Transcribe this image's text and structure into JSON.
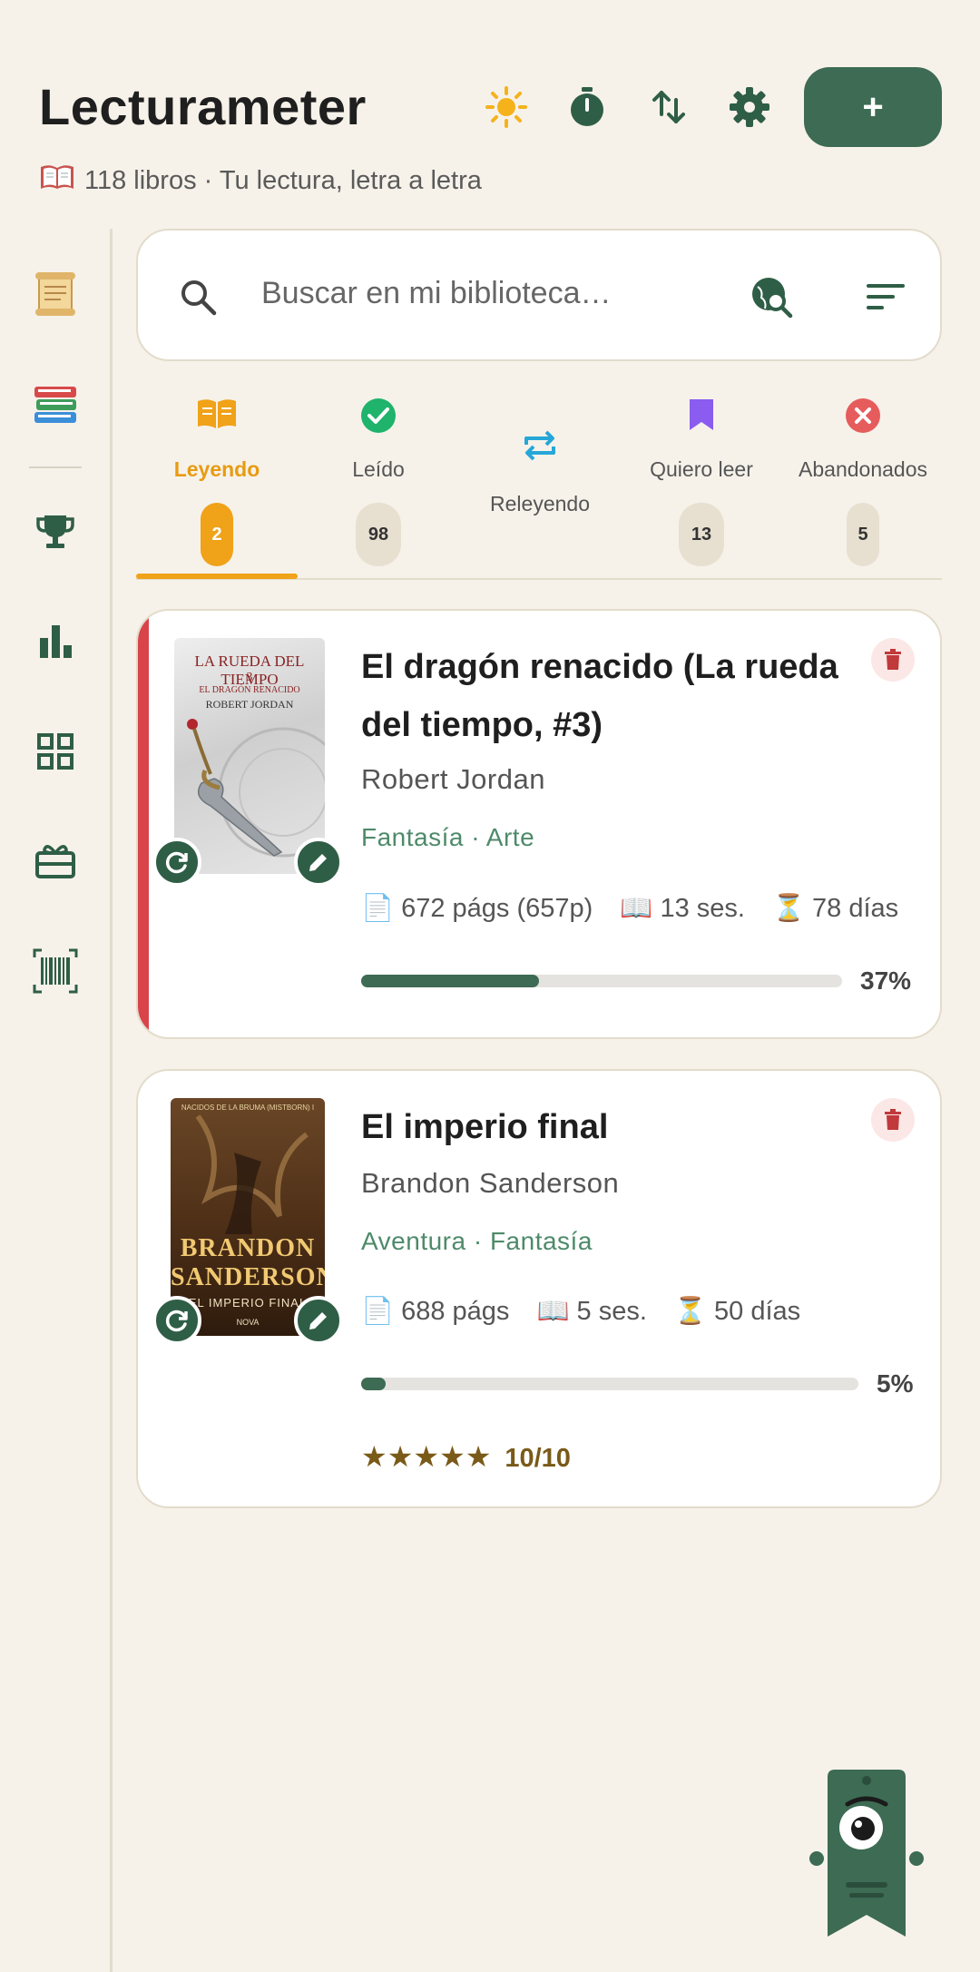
{
  "app": {
    "title": "Lecturameter",
    "subtitle_icon": "open-book-emoji",
    "subtitle": "118 libros · Tu lectura, letra a letra",
    "add_label": "+"
  },
  "header_icons": [
    "sun-icon",
    "timer-icon",
    "sort-arrows-icon",
    "gear-icon"
  ],
  "sidebar": {
    "items": [
      {
        "icon": "scroll-icon"
      },
      {
        "icon": "books-stack-icon"
      },
      {
        "icon": "trophy-icon"
      },
      {
        "icon": "bar-chart-icon"
      },
      {
        "icon": "grid-icon"
      },
      {
        "icon": "gift-card-icon"
      },
      {
        "icon": "barcode-icon"
      }
    ]
  },
  "search": {
    "placeholder": "Buscar en mi biblioteca…"
  },
  "tabs": [
    {
      "label": "Leyendo",
      "count": "2",
      "active": true,
      "icon": "open-book-icon",
      "color": "#f0a218"
    },
    {
      "label": "Leído",
      "count": "98",
      "icon": "check-circle-icon",
      "color": "#1fb36c"
    },
    {
      "label": "Releyendo",
      "count": "",
      "icon": "repeat-icon",
      "color": "#26a7d8"
    },
    {
      "label": "Quiero leer",
      "count": "13",
      "icon": "bookmark-icon",
      "color": "#8a5cf0"
    },
    {
      "label": "Abandonados",
      "count": "5",
      "icon": "x-circle-icon",
      "color": "#e65c5c"
    }
  ],
  "books": [
    {
      "title": "El dragón renacido (La rueda del tiempo, #3)",
      "author": "Robert Jordan",
      "genres": "Fantasía · Arte",
      "pages": "672 págs (657p)",
      "sessions": "13 ses.",
      "days": "78 días",
      "progress": 0.37,
      "progress_label": "37%",
      "cover": {
        "series": "LA RUEDA DEL TIEMPO",
        "number": "3",
        "subtitle": "EL DRAGÓN RENACIDO",
        "author": "ROBERT JORDAN"
      }
    },
    {
      "title": "El imperio final",
      "author": "Brandon Sanderson",
      "genres": "Aventura · Fantasía",
      "pages": "688 págs",
      "sessions": "5 ses.",
      "days": "50 días",
      "progress": 0.05,
      "progress_label": "5%",
      "rating_stars": "★★★★★",
      "rating": "10/10",
      "cover": {
        "series": "NACIDOS DE LA BRUMA (MISTBORN) I",
        "author_line1": "BRANDON",
        "author_line2": "SANDERSON",
        "title": "EL IMPERIO FINAL",
        "publisher": "NOVA"
      }
    }
  ]
}
